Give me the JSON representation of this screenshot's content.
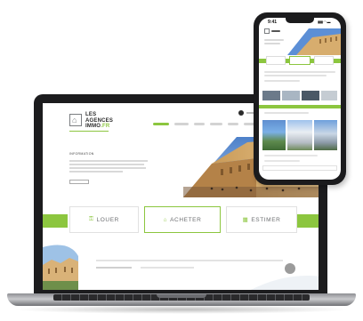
{
  "site": {
    "logo_line1": "LES",
    "logo_line2": "AGENCES",
    "logo_line3": "IMMO",
    "logo_suffix": ".FR",
    "brand_color": "#8cc63f",
    "info_heading": "INFORMATION"
  },
  "actions": [
    {
      "label": "LOUER",
      "icon": "key-icon",
      "active": false
    },
    {
      "label": "ACHETER",
      "icon": "house-icon",
      "active": true
    },
    {
      "label": "ESTIMER",
      "icon": "calculator-icon",
      "active": false
    }
  ],
  "phone": {
    "time": "9:41",
    "status_icons": "▮▮▮ ◠ ▬"
  }
}
